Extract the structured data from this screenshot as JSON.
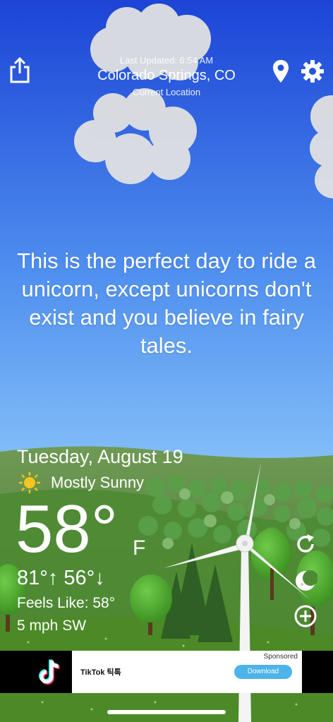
{
  "header": {
    "last_updated": "Last Updated: 6:54 AM",
    "location": "Colorado Springs, CO",
    "location_sub": "Current Location"
  },
  "quote": "This is the perfect day to ride a unicorn, except unicorns don't exist and you believe in fairy tales.",
  "weather": {
    "date": "Tuesday, August 19",
    "condition": "Mostly Sunny",
    "condition_icon": "sun-icon",
    "temperature": "58°",
    "unit": "F",
    "high_low": "81°↑ 56°↓",
    "feels_like": "Feels Like: 58°",
    "wind": "5 mph SW"
  },
  "icons": {
    "share": "share-icon",
    "location": "location-pin-icon",
    "settings": "gear-icon",
    "refresh": "refresh-icon",
    "moon": "moon-icon",
    "add": "plus-circle-icon"
  },
  "ad": {
    "sponsored": "Sponsored",
    "title": "TikTok 틱톡",
    "button": "Download"
  },
  "colors": {
    "sky_top": "#1a45d8",
    "sky_bottom": "#6fb4f7",
    "hills": "#5f8f3c",
    "grass": "#4f8d2a",
    "accent_button": "#4db3e8"
  }
}
